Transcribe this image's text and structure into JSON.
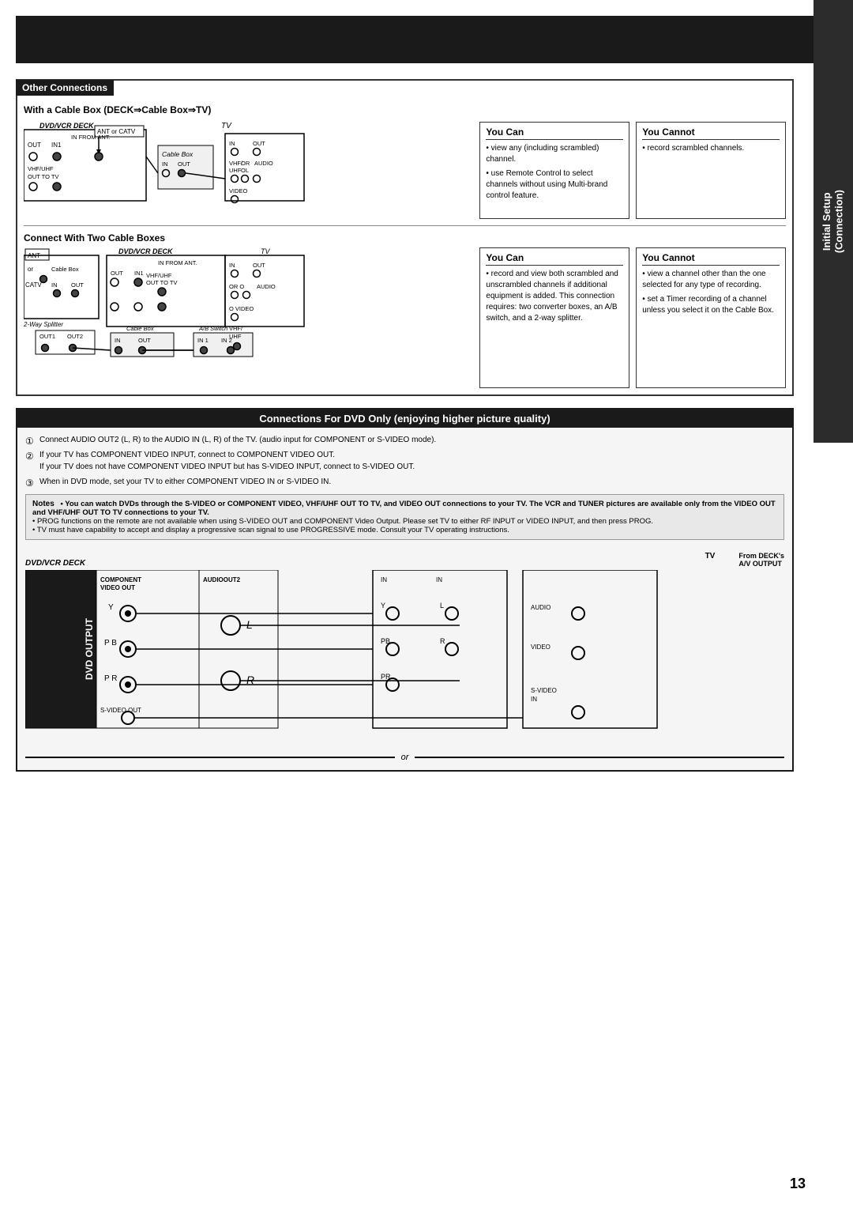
{
  "page": {
    "number": "13",
    "background": "#ffffff"
  },
  "sidebar": {
    "label_line1": "Initial Setup",
    "label_line2": "(Connection)"
  },
  "top_banner": {
    "visible": true
  },
  "other_connections": {
    "header": "Other Connections",
    "title": "With a Cable Box (DECK⇒Cable Box⇒TV)",
    "deck_label": "DVD/VCR DECK",
    "ant_catv_label": "ANT or CATV",
    "tv_label": "TV",
    "cable_box_label": "Cable Box",
    "ports": {
      "out": "OUT",
      "in1": "IN1",
      "in_from_ant": "IN FROM ANT.",
      "vhf_uhf": "VHF/UHF",
      "out_to_tv": "OUT TO TV",
      "in": "IN",
      "out_tv": "OUT",
      "vhf": "VHF/",
      "uhf": "UHF",
      "or": "OR",
      "ol": "OL",
      "audio": "AUDIO",
      "video": "VIDEO"
    },
    "you_can": {
      "header": "You Can",
      "items": [
        "view any (including scrambled) channel.",
        "use Remote Control to select channels without using Multi-brand control feature."
      ]
    },
    "you_cannot": {
      "header": "You Cannot",
      "items": [
        "record scrambled channels."
      ]
    }
  },
  "two_cable": {
    "header": "Connect With Two Cable Boxes",
    "deck_label": "DVD/VCR DECK",
    "tv_label": "TV",
    "ant_label": "ANT",
    "or_label": "or",
    "catv_label": "CATV",
    "cable_box_label": "Cable Box",
    "cable_box2_label": "Cable Box",
    "splitter_label": "2-Way Splitter",
    "ab_switch_label": "A/B Switch",
    "out1_label": "OUT1",
    "out2_label": "OUT2",
    "in1_label": "IN 1",
    "in2_label": "IN 2",
    "ports": {
      "in_from_ant": "IN FROM ANT.",
      "out": "OUT",
      "in1": "IN1",
      "vhf_uhf": "VHF/UHF",
      "out_to_tv": "OUT TO TV",
      "in": "IN",
      "out2": "OUT",
      "or": "OR",
      "audio": "AUDIO",
      "video": "VIDEO",
      "vhf_uhf2": "VHF/",
      "uhf2": "UHF"
    },
    "you_can": {
      "header": "You Can",
      "items": [
        "record and view both scrambled and unscrambled channels if additional equipment is added. This connection requires: two converter boxes, an A/B switch, and a 2-way splitter."
      ]
    },
    "you_cannot": {
      "header": "You Cannot",
      "items": [
        "view a channel other than the one selected for any type of recording.",
        "set a Timer recording of a channel unless you select it on the Cable Box."
      ]
    }
  },
  "dvd_only": {
    "header": "Connections For DVD Only (enjoying higher picture quality)",
    "steps": [
      "Connect AUDIO OUT2 (L, R) to the AUDIO IN (L, R) of the TV. (audio input for COMPONENT or S-VIDEO mode).",
      "If your TV has COMPONENT VIDEO INPUT, connect to COMPONENT VIDEO OUT.\nIf your TV does not have COMPONENT VIDEO INPUT but has S-VIDEO INPUT, connect to S-VIDEO OUT.",
      "When in DVD mode, set your TV to either COMPONENT VIDEO IN or S-VIDEO IN."
    ],
    "notes": {
      "label": "Notes",
      "items": [
        "You can watch DVDs through the S-VIDEO or COMPONENT VIDEO, VHF/UHF OUT TO TV, and VIDEO OUT connections to your TV. The VCR and TUNER pictures are available only from the VIDEO OUT and VHF/UHF OUT TO TV connections to your TV.",
        "PROG functions on the remote are not available when using S-VIDEO OUT and COMPONENT Video Output. Please set TV to either RF INPUT or VIDEO INPUT, and then press PROG.",
        "TV must have capability to accept and display a progressive scan signal to use PROGRESSIVE mode. Consult your TV operating instructions."
      ]
    },
    "deck_label": "DVD/VCR DECK",
    "tv_label": "TV",
    "from_decks": "From DECK's",
    "av_output": "A/V OUTPUT",
    "dvd_output_label": "DVD OUTPUT",
    "component_video_out": "COMPONENT VIDEO OUT",
    "audio_out2": "AUDIOOUT2",
    "y_label": "Y",
    "pb_label": "P B",
    "pr_label": "P R",
    "l_label": "L",
    "r_label": "R",
    "s_video_out": "S-VIDEO OUT",
    "or_label": "or",
    "tv_in_labels": {
      "in": "IN",
      "y": "Y",
      "l": "L",
      "pb": "PB",
      "r": "R",
      "pr": "PR",
      "audio": "AUDIO",
      "video": "VIDEO",
      "s_video": "S-VIDEO",
      "s_in": "IN"
    }
  }
}
